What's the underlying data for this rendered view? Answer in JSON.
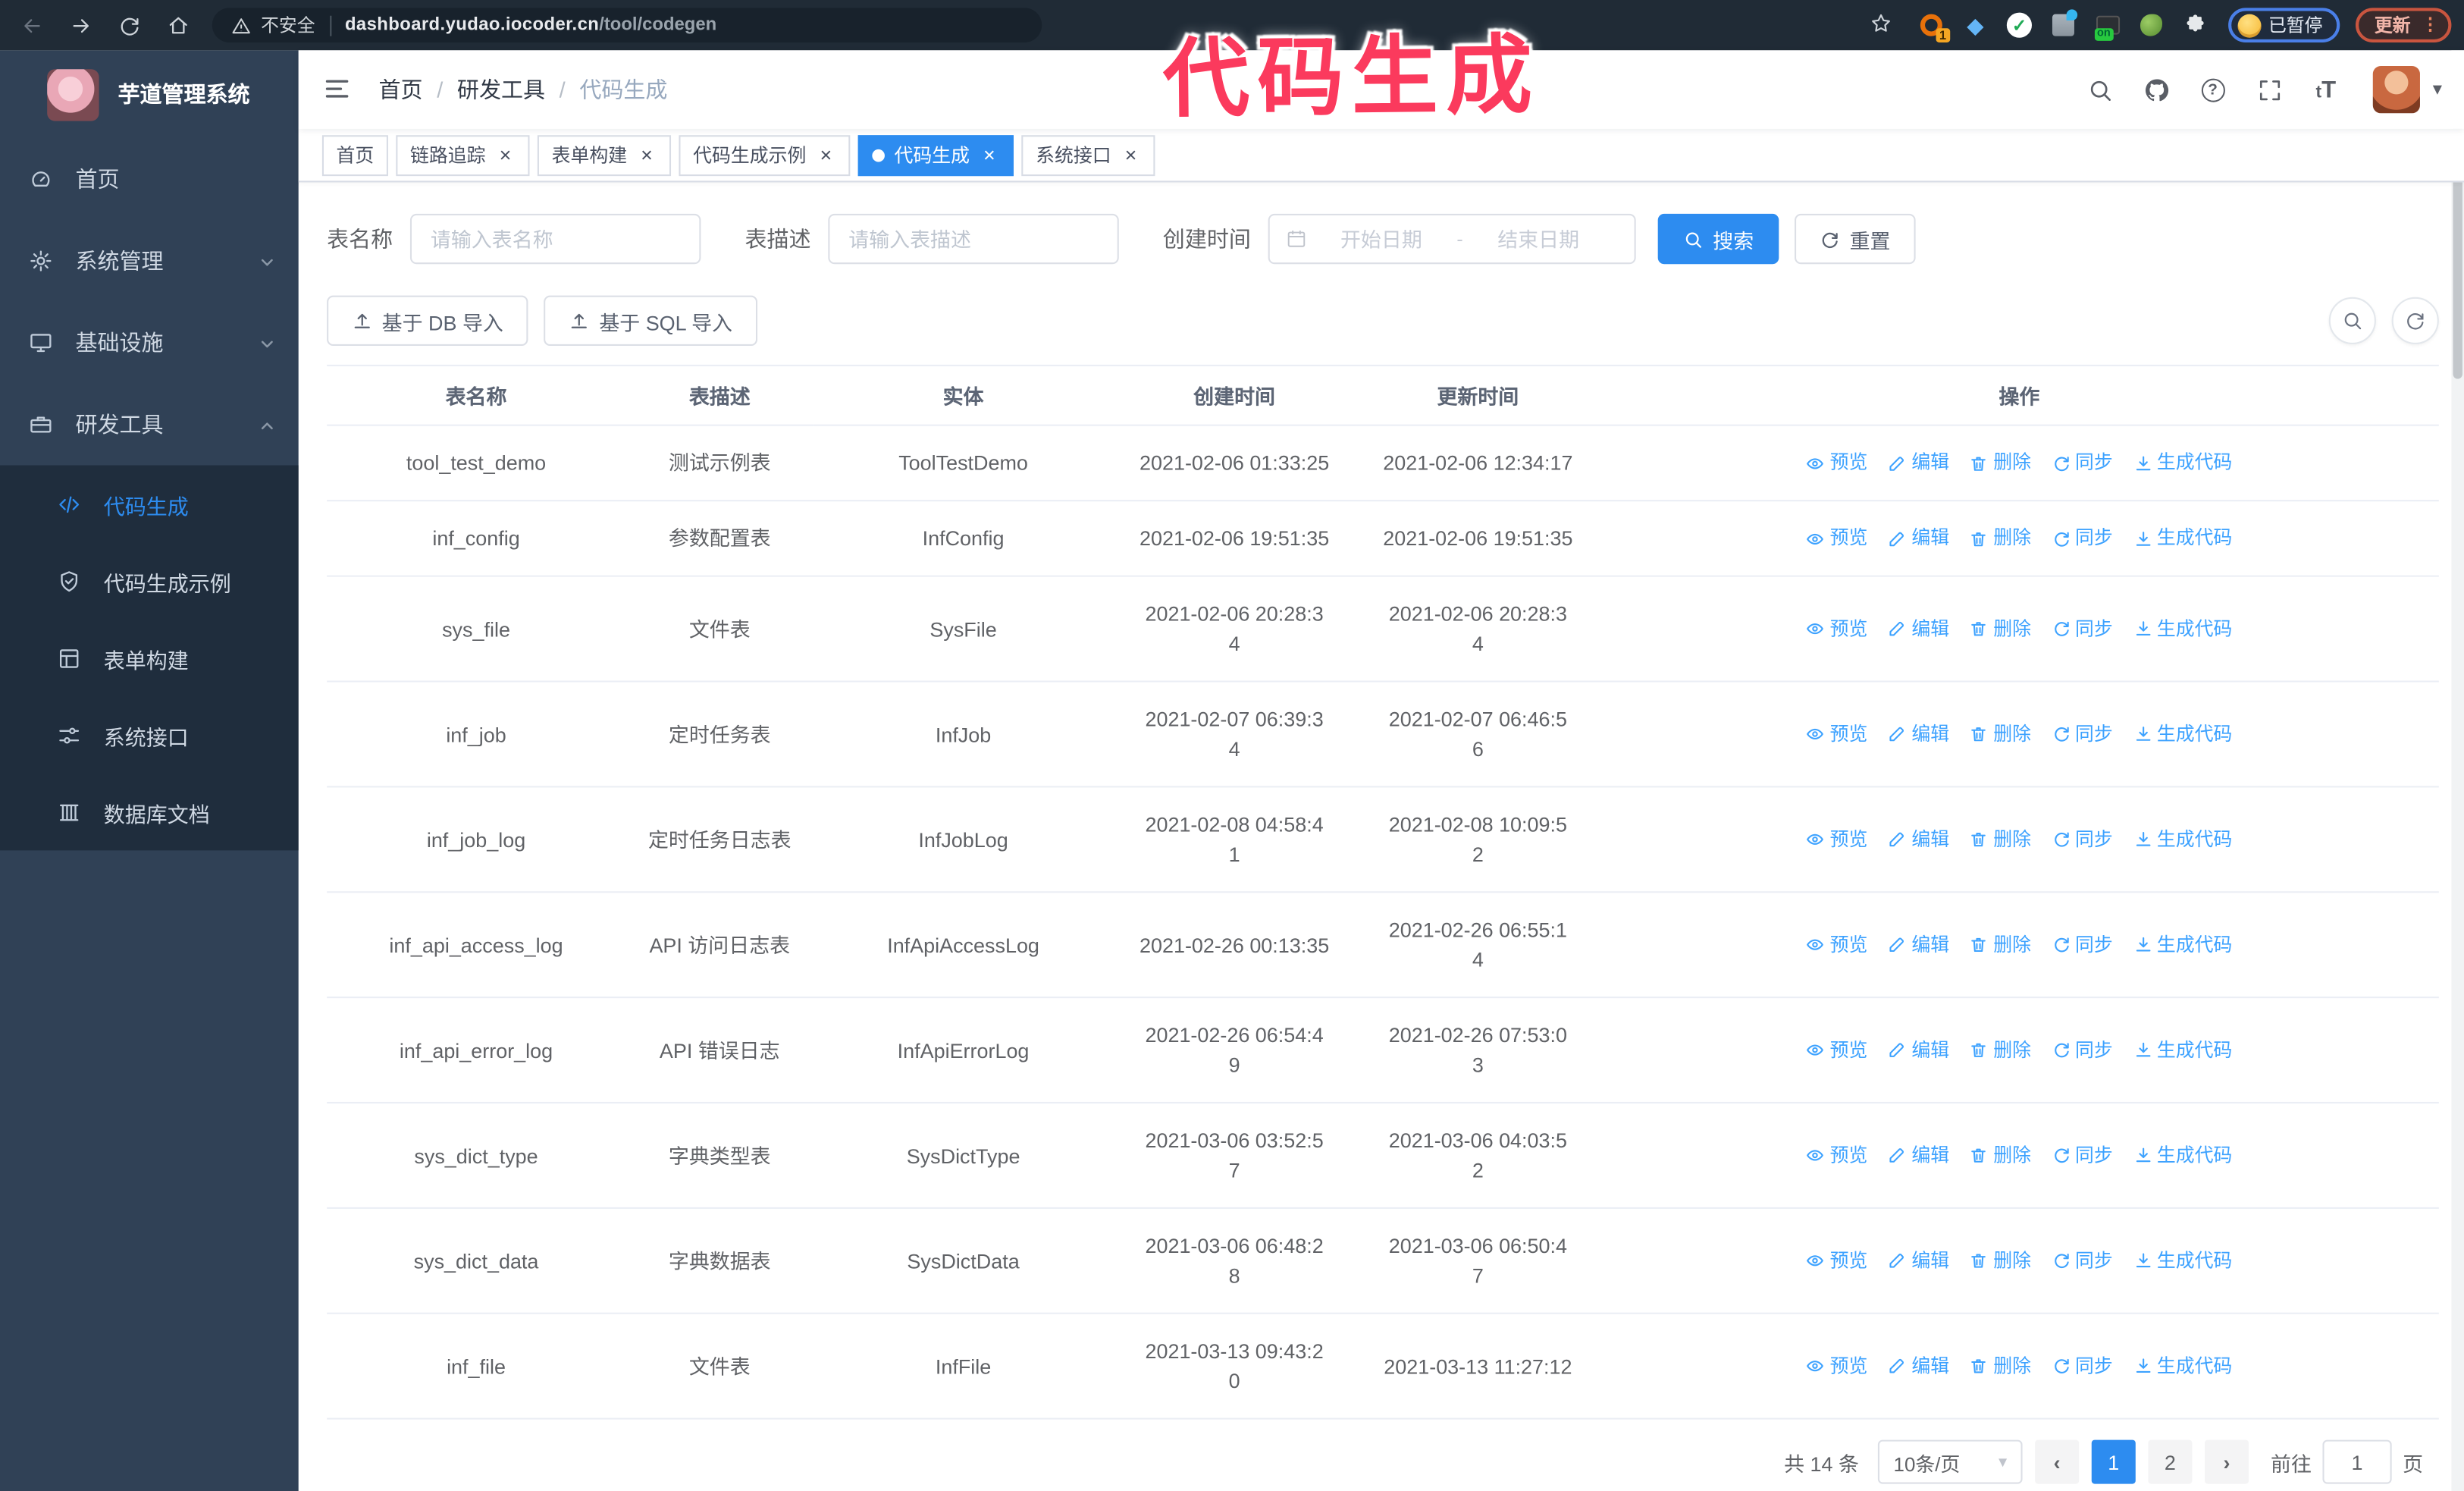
{
  "colors": {
    "accent": "#2d8cf0",
    "link": "#3da2ff",
    "sidebar_bg": "#304156",
    "submenu_bg": "#1f2d3d",
    "annotation": "#fb3a5d"
  },
  "browser": {
    "security_label": "不安全",
    "url_host": "dashboard.yudao.iocoder.cn",
    "url_path": "/tool/codegen",
    "paused_badge": "已暂停",
    "update_label": "更新"
  },
  "annotation": {
    "text": "代码生成"
  },
  "sidebar": {
    "app_title": "芋道管理系统",
    "menu": [
      {
        "label": "首页",
        "icon": "dashboard-icon",
        "arrow": ""
      },
      {
        "label": "系统管理",
        "icon": "gear-icon",
        "arrow": "down"
      },
      {
        "label": "基础设施",
        "icon": "monitor-icon",
        "arrow": "down"
      },
      {
        "label": "研发工具",
        "icon": "toolbox-icon",
        "arrow": "up"
      }
    ],
    "submenu": [
      {
        "label": "代码生成",
        "icon": "code-icon",
        "active": true
      },
      {
        "label": "代码生成示例",
        "icon": "shield-check-icon",
        "active": false
      },
      {
        "label": "表单构建",
        "icon": "form-icon",
        "active": false
      },
      {
        "label": "系统接口",
        "icon": "api-icon",
        "active": false
      },
      {
        "label": "数据库文档",
        "icon": "database-icon",
        "active": false
      }
    ]
  },
  "header": {
    "breadcrumb": [
      "首页",
      "研发工具",
      "代码生成"
    ]
  },
  "tabs": [
    {
      "label": "首页",
      "closable": false,
      "active": false
    },
    {
      "label": "链路追踪",
      "closable": true,
      "active": false
    },
    {
      "label": "表单构建",
      "closable": true,
      "active": false
    },
    {
      "label": "代码生成示例",
      "closable": true,
      "active": false
    },
    {
      "label": "代码生成",
      "closable": true,
      "active": true
    },
    {
      "label": "系统接口",
      "closable": true,
      "active": false
    }
  ],
  "filters": {
    "table_name_label": "表名称",
    "table_name_placeholder": "请输入表名称",
    "table_desc_label": "表描述",
    "table_desc_placeholder": "请输入表描述",
    "create_time_label": "创建时间",
    "date_start_placeholder": "开始日期",
    "date_separator": "-",
    "date_end_placeholder": "结束日期",
    "search_label": "搜索",
    "reset_label": "重置"
  },
  "toolbar": {
    "import_db": "基于 DB 导入",
    "import_sql": "基于 SQL 导入"
  },
  "table": {
    "columns": [
      "表名称",
      "表描述",
      "实体",
      "创建时间",
      "更新时间",
      "操作"
    ],
    "action_labels": [
      "预览",
      "编辑",
      "删除",
      "同步",
      "生成代码"
    ],
    "action_icons": [
      "eye-icon",
      "edit-icon",
      "delete-icon",
      "sync-icon",
      "download-icon"
    ],
    "rows": [
      {
        "name": "tool_test_demo",
        "desc": "测试示例表",
        "entity": "ToolTestDemo",
        "created": "2021-02-06 01:33:25",
        "updated": "2021-02-06 12:34:17"
      },
      {
        "name": "inf_config",
        "desc": "参数配置表",
        "entity": "InfConfig",
        "created": "2021-02-06 19:51:35",
        "updated": "2021-02-06 19:51:35"
      },
      {
        "name": "sys_file",
        "desc": "文件表",
        "entity": "SysFile",
        "created": "2021-02-06 20:28:3\n4",
        "updated": "2021-02-06 20:28:3\n4"
      },
      {
        "name": "inf_job",
        "desc": "定时任务表",
        "entity": "InfJob",
        "created": "2021-02-07 06:39:3\n4",
        "updated": "2021-02-07 06:46:5\n6"
      },
      {
        "name": "inf_job_log",
        "desc": "定时任务日志表",
        "entity": "InfJobLog",
        "created": "2021-02-08 04:58:4\n1",
        "updated": "2021-02-08 10:09:5\n2"
      },
      {
        "name": "inf_api_access_log",
        "desc": "API 访问日志表",
        "entity": "InfApiAccessLog",
        "created": "2021-02-26 00:13:35",
        "updated": "2021-02-26 06:55:1\n4"
      },
      {
        "name": "inf_api_error_log",
        "desc": "API 错误日志",
        "entity": "InfApiErrorLog",
        "created": "2021-02-26 06:54:4\n9",
        "updated": "2021-02-26 07:53:0\n3"
      },
      {
        "name": "sys_dict_type",
        "desc": "字典类型表",
        "entity": "SysDictType",
        "created": "2021-03-06 03:52:5\n7",
        "updated": "2021-03-06 04:03:5\n2"
      },
      {
        "name": "sys_dict_data",
        "desc": "字典数据表",
        "entity": "SysDictData",
        "created": "2021-03-06 06:48:2\n8",
        "updated": "2021-03-06 06:50:4\n7"
      },
      {
        "name": "inf_file",
        "desc": "文件表",
        "entity": "InfFile",
        "created": "2021-03-13 09:43:2\n0",
        "updated": "2021-03-13 11:27:12"
      }
    ]
  },
  "pagination": {
    "total": "共 14 条",
    "page_size": "10条/页",
    "pages": [
      "1",
      "2"
    ],
    "active_page": "1",
    "goto_label": "前往",
    "goto_value": "1",
    "unit_label": "页"
  }
}
